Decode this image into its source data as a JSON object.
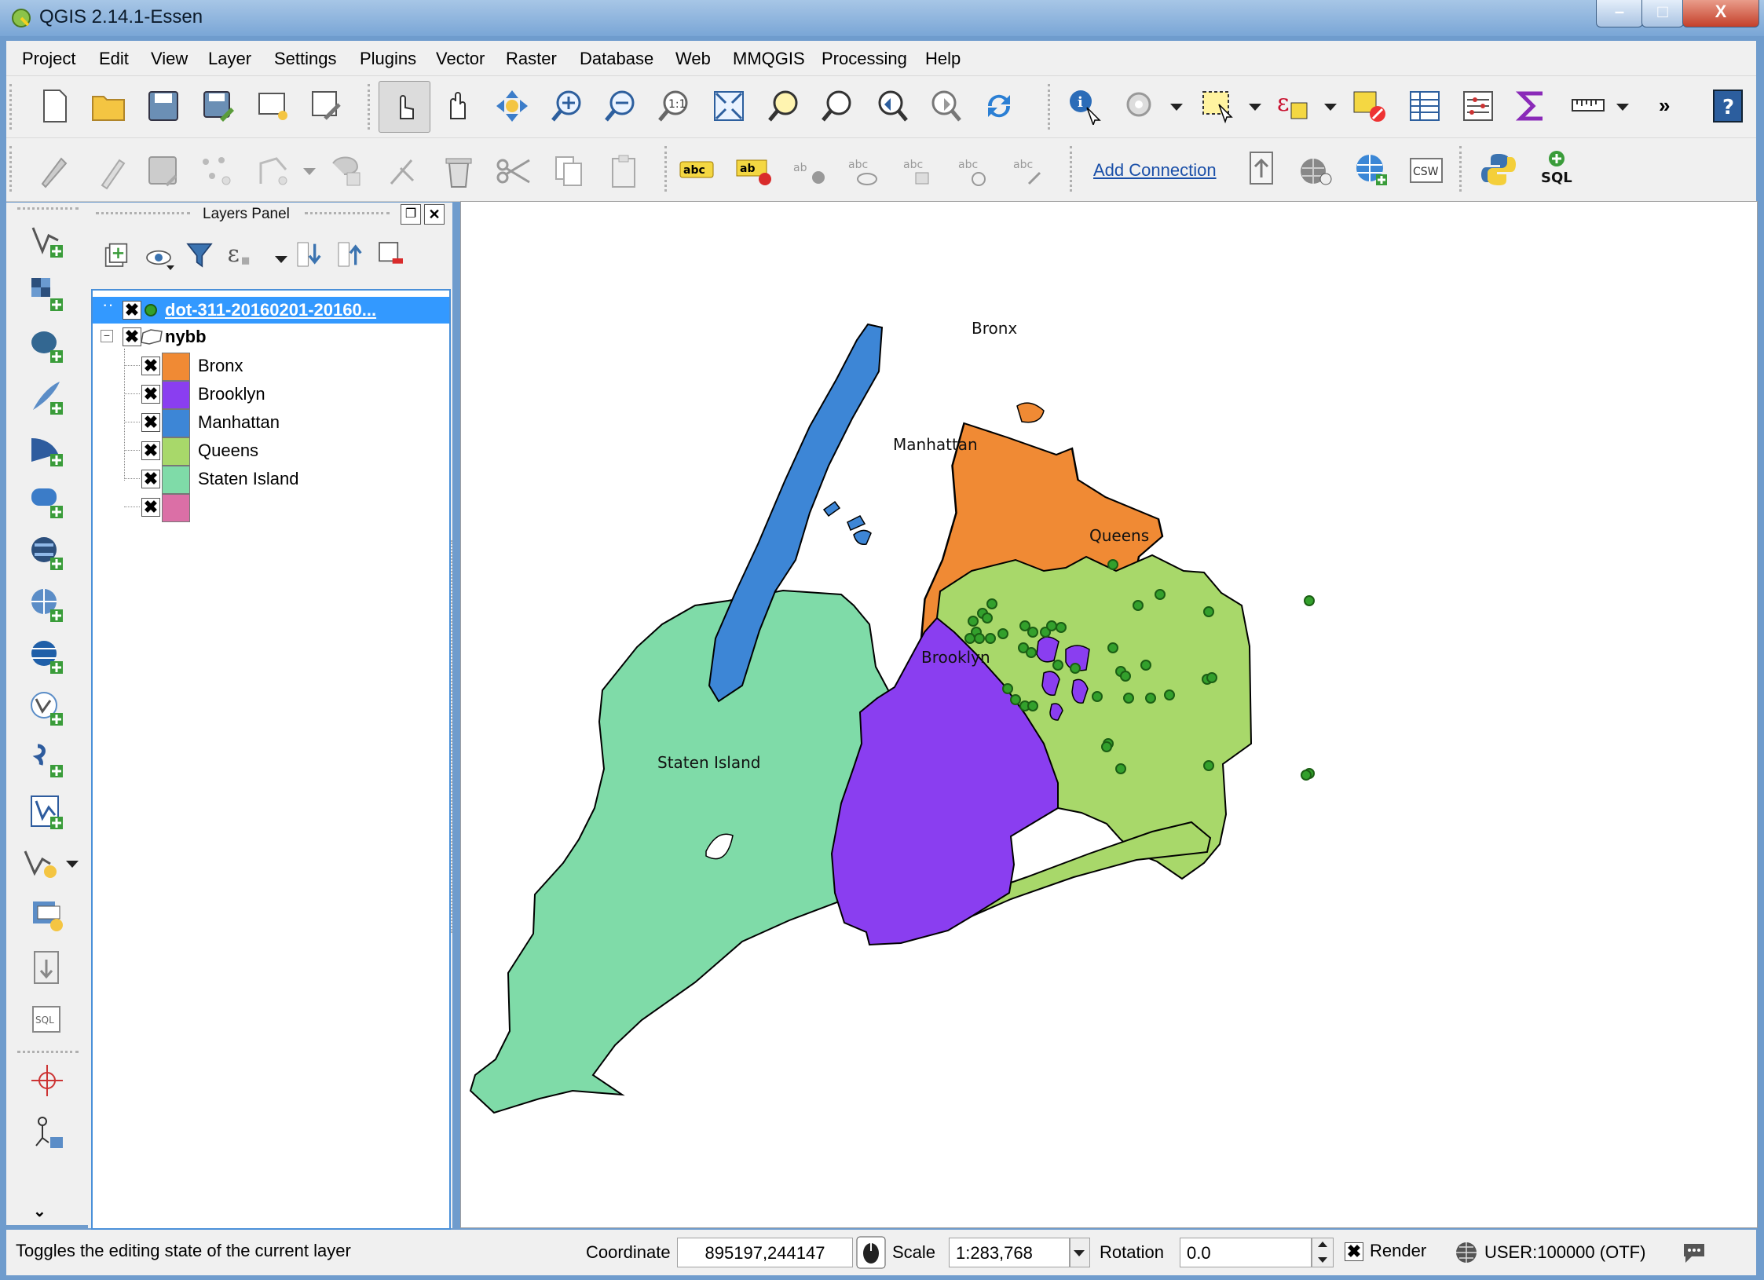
{
  "window": {
    "title": "QGIS 2.14.1-Essen",
    "minimize": "–",
    "maximize": "□",
    "close": "X"
  },
  "menu": [
    "Project",
    "Edit",
    "View",
    "Layer",
    "Settings",
    "Plugins",
    "Vector",
    "Raster",
    "Database",
    "Web",
    "MMQGIS",
    "Processing",
    "Help"
  ],
  "toolbar": {
    "add_connection": "Add Connection",
    "csw": "CSW",
    "sql": "SQL",
    "more": "»",
    "abc": "abc",
    "one_to_one": "1:1"
  },
  "layers_panel": {
    "title": "Layers Panel",
    "layers": [
      {
        "name": "dot-311-20160201-20160...",
        "type": "point",
        "checked": true,
        "color": "#33a02c"
      },
      {
        "name": "nybb",
        "type": "polygon-group",
        "checked": true,
        "collapsed_symbol": "⊟"
      }
    ],
    "categories": [
      {
        "label": "Bronx",
        "color": "#f08a34",
        "checked": true
      },
      {
        "label": "Brooklyn",
        "color": "#8a3ef0",
        "checked": true
      },
      {
        "label": "Manhattan",
        "color": "#3d86d6",
        "checked": true
      },
      {
        "label": "Queens",
        "color": "#a8d86a",
        "checked": true
      },
      {
        "label": "Staten Island",
        "color": "#7fdba8",
        "checked": true
      },
      {
        "label": "",
        "color": "#db6fa6",
        "checked": true
      }
    ]
  },
  "map": {
    "labels": {
      "bronx": "Bronx",
      "manhattan": "Manhattan",
      "queens": "Queens",
      "brooklyn": "Brooklyn",
      "staten": "Staten Island"
    },
    "colors": {
      "bronx": "#f08a34",
      "manhattan": "#3d86d6",
      "queens": "#a8d86a",
      "brooklyn": "#8a3ef0",
      "staten": "#7fdba8",
      "points": "#33a02c"
    }
  },
  "status": {
    "message": "Toggles the editing state of the current layer",
    "coordinate_label": "Coordinate",
    "coordinate_value": "895197,244147",
    "scale_label": "Scale",
    "scale_value": "1:283,768",
    "rotation_label": "Rotation",
    "rotation_value": "0.0",
    "render_label": "Render",
    "render_checked": true,
    "crs": "USER:100000 (OTF)"
  }
}
